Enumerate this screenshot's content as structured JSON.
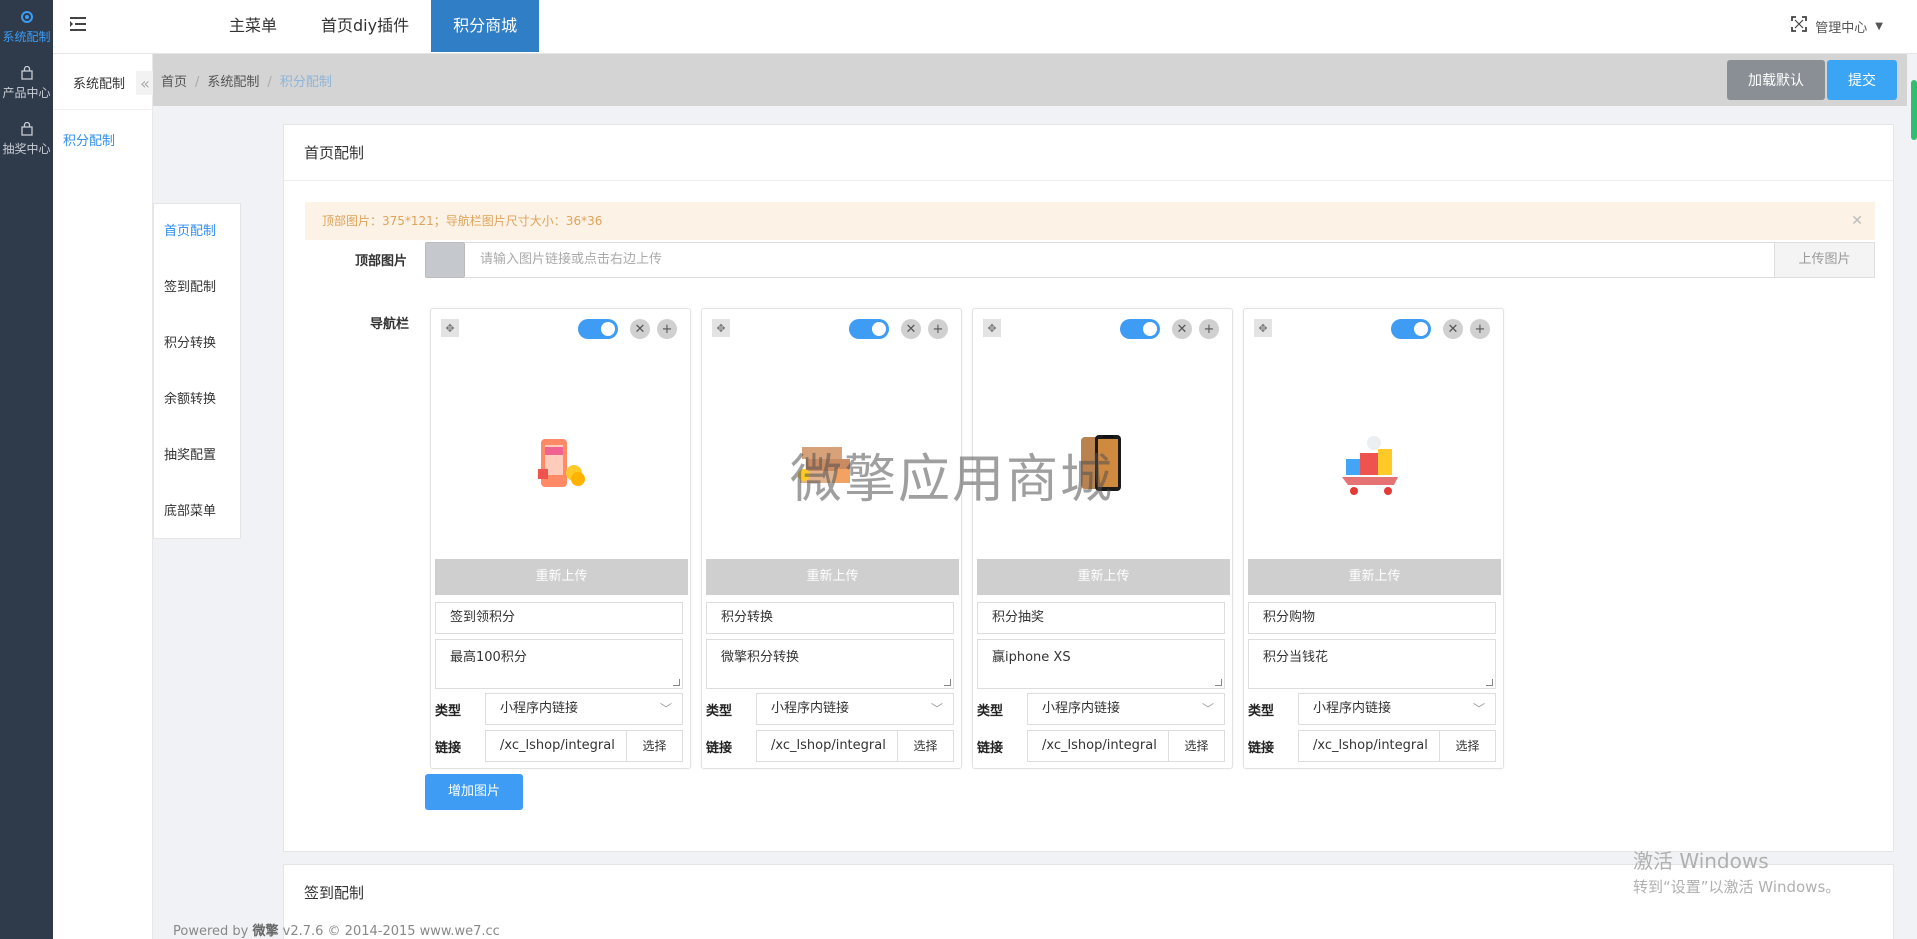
{
  "rail": [
    {
      "label": "系统配制",
      "icon": "gear-icon"
    },
    {
      "label": "产品中心",
      "icon": "bag-icon"
    },
    {
      "label": "抽奖中心",
      "icon": "bag-icon"
    }
  ],
  "subnav": {
    "header": "系统配制",
    "link": "积分配制"
  },
  "topbar": {
    "tabs": [
      "主菜单",
      "首页diy插件",
      "积分商城"
    ],
    "active_tab": "积分商城",
    "admin": "管理中心"
  },
  "breadcrumb": {
    "home": "首页",
    "section": "系统配制",
    "current": "积分配制"
  },
  "actions": {
    "load_default": "加载默认",
    "submit": "提交"
  },
  "config_nav": [
    "首页配制",
    "签到配制",
    "积分转换",
    "余额转换",
    "抽奖配置",
    "底部菜单"
  ],
  "panel": {
    "title": "首页配制",
    "alert": "顶部图片：375*121；导航栏图片尺寸大小：36*36",
    "top_image_label": "顶部图片",
    "top_image_placeholder": "请输入图片链接或点击右边上传",
    "upload_label": "上传图片",
    "nav_label": "导航栏",
    "cards": [
      {
        "title": "签到领积分",
        "desc": "最高100积分",
        "type": "小程序内链接",
        "link": "/xc_lshop/integral",
        "image_icon": "gift-shop-icon"
      },
      {
        "title": "积分转换",
        "desc": "微擎积分转换",
        "type": "小程序内链接",
        "link": "/xc_lshop/integral",
        "image_icon": "boxes-icon"
      },
      {
        "title": "积分抽奖",
        "desc": "赢iphone XS",
        "type": "小程序内链接",
        "link": "/xc_lshop/integral",
        "image_icon": "phone-icon"
      },
      {
        "title": "积分购物",
        "desc": "积分当钱花",
        "type": "小程序内链接",
        "link": "/xc_lshop/integral",
        "image_icon": "shopping-cart-icon"
      }
    ],
    "reupload": "重新上传",
    "type_label": "类型",
    "link_label": "链接",
    "choose": "选择",
    "add_image": "增加图片"
  },
  "panel2": {
    "title": "签到配制"
  },
  "watermark": "微擎应用商城",
  "windows": {
    "line1": "激活 Windows",
    "line2": "转到“设置”以激活 Windows。"
  },
  "footer": {
    "prefix": "Powered by ",
    "brand": "微擎",
    "rest": " v2.7.6 © 2014-2015 www.we7.cc"
  },
  "colors": {
    "accent": "#2f7ec6",
    "primary": "#3e9cf5",
    "rail": "#2f3a4a",
    "alert_bg": "#fcf2e6",
    "alert_text": "#e0a35a"
  }
}
